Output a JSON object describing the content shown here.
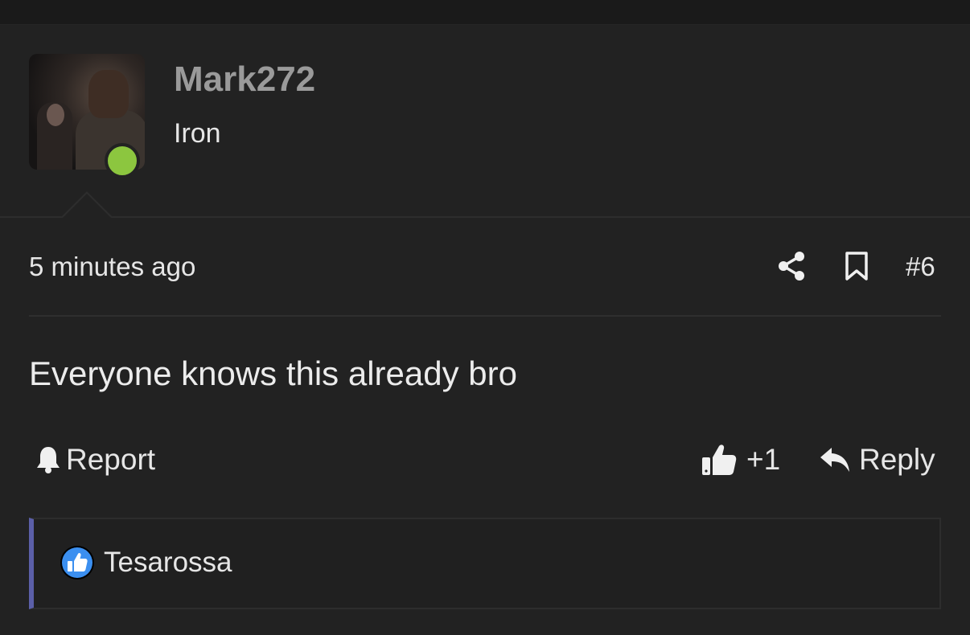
{
  "user": {
    "username": "Mark272",
    "rank": "Iron",
    "online_status_color": "#8cc63f"
  },
  "post": {
    "timestamp": "5 minutes ago",
    "number": "#6",
    "message": "Everyone knows this already bro"
  },
  "actions": {
    "report_label": "Report",
    "like_label": "+1",
    "reply_label": "Reply"
  },
  "reactions": {
    "users": [
      "Tesarossa"
    ],
    "accent_color": "#5b5fa8",
    "icon": "thumbs-up-reaction-icon"
  },
  "icons": {
    "share": "share-icon",
    "bookmark": "bookmark-icon",
    "report": "bell-icon",
    "like": "thumbs-up-icon",
    "reply": "reply-arrow-icon"
  }
}
